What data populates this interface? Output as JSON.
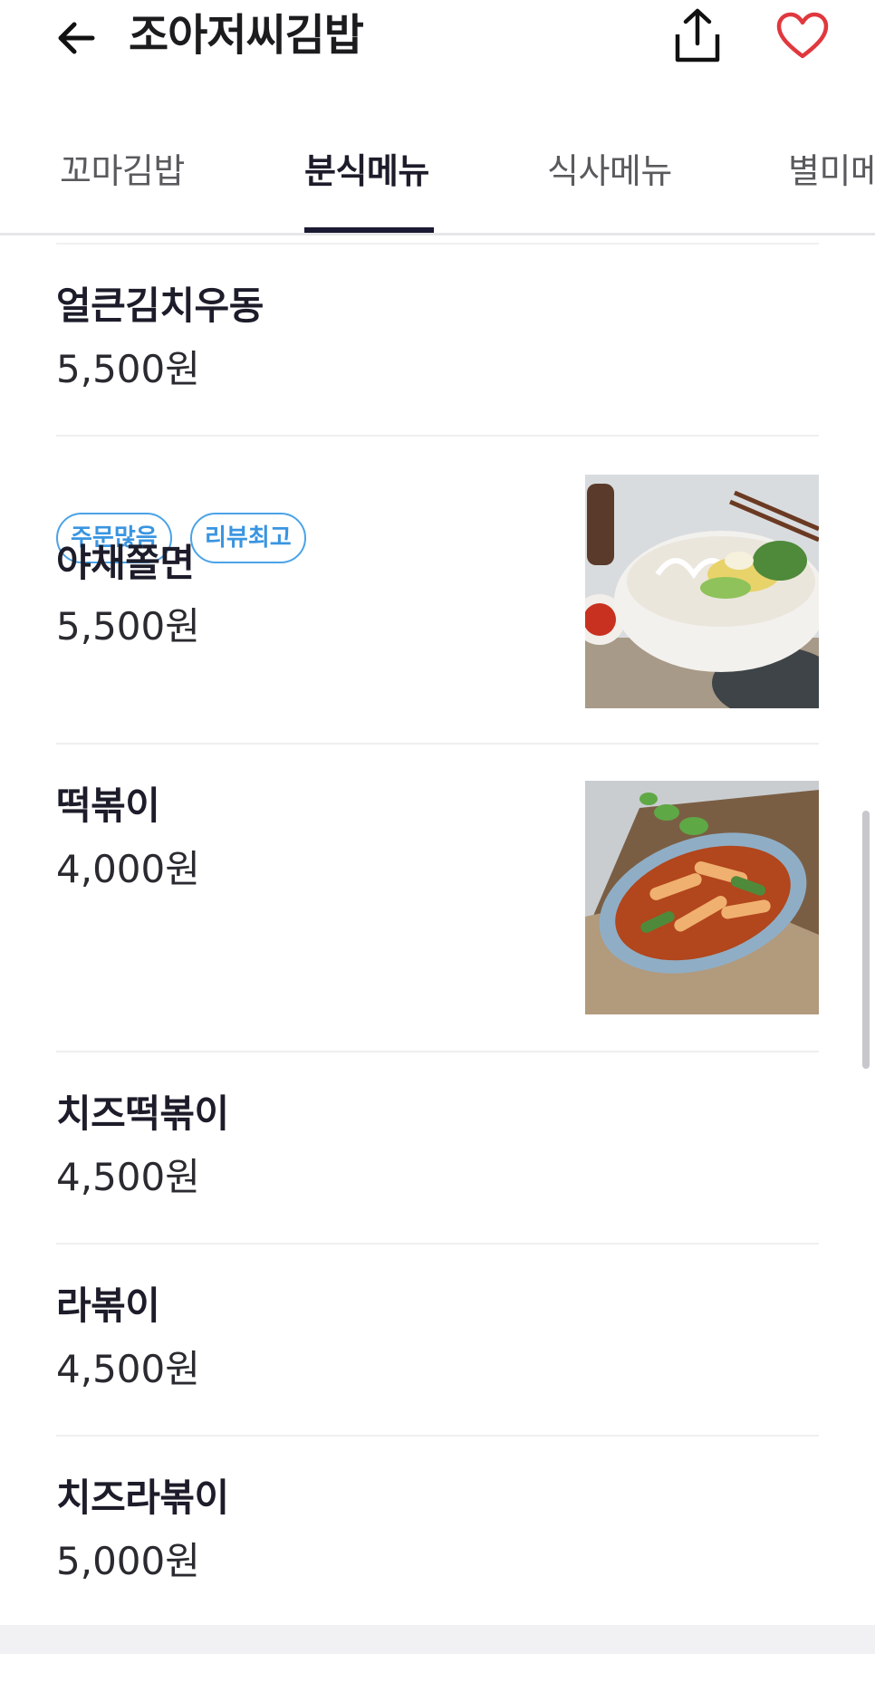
{
  "header": {
    "back_icon": "arrow-left-icon",
    "title": "조아저씨김밥",
    "share_icon": "share-icon",
    "favorite_icon": "heart-icon",
    "favorite_color": "#e0383e"
  },
  "tabs": [
    {
      "label": "꼬마김밥",
      "active": false
    },
    {
      "label": "분식메뉴",
      "active": true
    },
    {
      "label": "식사메뉴",
      "active": false
    },
    {
      "label": "별미메뉴",
      "active": false
    }
  ],
  "menu": [
    {
      "name": "얼큰김치우동",
      "price": "5,500원"
    },
    {
      "name": "야채쫄면",
      "price": "5,500원",
      "badges": [
        "주문많음",
        "리뷰최고"
      ],
      "image": "jjolmyeon-photo"
    },
    {
      "name": "떡볶이",
      "price": "4,000원",
      "image": "tteokbokki-photo"
    },
    {
      "name": "치즈떡볶이",
      "price": "4,500원"
    },
    {
      "name": "라볶이",
      "price": "4,500원"
    },
    {
      "name": "치즈라볶이",
      "price": "5,000원"
    }
  ],
  "colors": {
    "accent_text": "#1c1c2a",
    "badge_blue": "#3a95e0",
    "tab_indicator": "#1a1a33"
  }
}
